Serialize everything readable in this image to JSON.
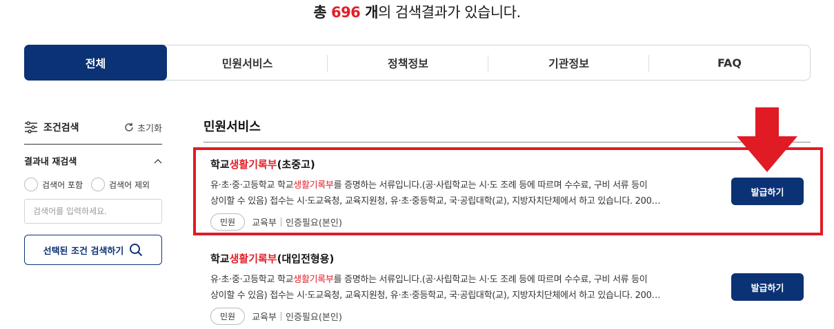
{
  "summary": {
    "prefix": "총 ",
    "count": "696",
    "unit": " 개",
    "suffix": "의 검색결과가 있습니다."
  },
  "tabs": [
    {
      "label": "전체",
      "active": true
    },
    {
      "label": "민원서비스"
    },
    {
      "label": "정책정보"
    },
    {
      "label": "기관정보"
    },
    {
      "label": "FAQ"
    }
  ],
  "sidebar": {
    "title": "조건검색",
    "reset_label": "초기화",
    "refine_label": "결과내 재검색",
    "include_label": "검색어 포함",
    "exclude_label": "검색어 제외",
    "search_placeholder": "검색어를 입력하세요.",
    "submit_label": "선택된 조건 검색하기"
  },
  "section_title": "민원서비스",
  "results": [
    {
      "title_pre": "학교",
      "title_hl": "생활기록부",
      "title_post": "(초중고)",
      "desc1_pre": "유·초·중·고등학교 학교",
      "desc1_hl": "생활기록부",
      "desc1_post": "를 증명하는 서류입니다.(공·사립학교는 시·도 조례 등에 따르며 수수료, 구비 서류 등이",
      "desc2": "상이할 수 있음) 접수는 시·도교육청, 교육지원청, 유·초·중등학교, 국·공립대학(교), 지방자치단체에서 하고 있습니다. 200…",
      "badge": "민원",
      "agency": "교육부",
      "auth": "인증필요(본인)",
      "button": "발급하기"
    },
    {
      "title_pre": "학교",
      "title_hl": "생활기록부",
      "title_post": "(대입전형용)",
      "desc1_pre": "유·초·중·고등학교 학교",
      "desc1_hl": "생활기록부",
      "desc1_post": "를 증명하는 서류입니다.(공·사립학교는 시·도 조례 등에 따르며 수수료, 구비 서류 등이",
      "desc2": "상이할 수 있음) 접수는 시·도교육청, 교육지원청, 유·초·중등학교, 국·공립대학(교), 지방자치단체에서 하고 있습니다. 200…",
      "badge": "민원",
      "agency": "교육부",
      "auth": "인증필요(본인)",
      "button": "발급하기"
    }
  ],
  "colors": {
    "primary": "#0b3274",
    "highlight": "#e0212a",
    "annotation": "#e01b24"
  }
}
